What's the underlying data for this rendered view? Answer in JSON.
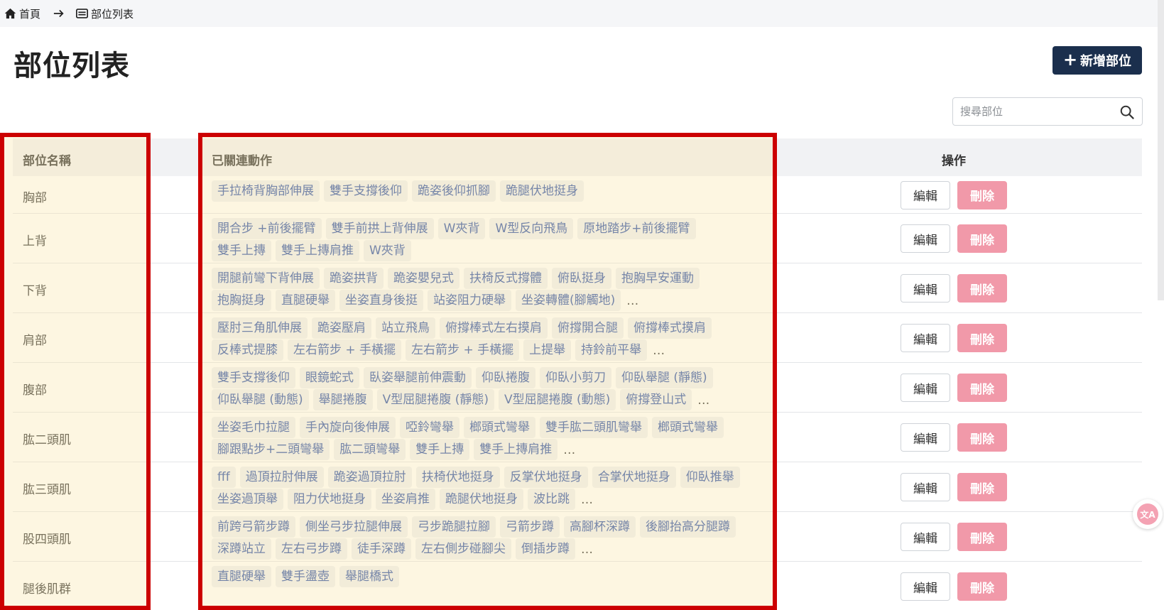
{
  "breadcrumb": {
    "home": "首頁",
    "current": "部位列表"
  },
  "page": {
    "title": "部位列表",
    "add_label": "新增部位"
  },
  "search": {
    "placeholder": "搜尋部位"
  },
  "table": {
    "headers": {
      "name": "部位名稱",
      "actions": "已關連動作",
      "ops": "操作"
    },
    "edit_label": "編輯",
    "delete_label": "刪除",
    "rows": [
      {
        "name": "胸部",
        "actions": [
          "手拉椅背胸部伸展",
          "雙手支撐後仰",
          "跪姿後仰抓腳",
          "跪腿伏地挺身"
        ],
        "more": ""
      },
      {
        "name": "上背",
        "actions": [
          "開合步 +前後擺臂",
          "雙手前拱上背伸展",
          "W夾背",
          "W型反向飛鳥",
          "原地踏步+前後擺臂",
          "雙手上摶",
          "雙手上摶肩推",
          "W夾背"
        ],
        "more": ""
      },
      {
        "name": "下背",
        "actions": [
          "開腿前彎下背伸展",
          "跪姿拱背",
          "跪姿嬰兒式",
          "扶椅反式撐體",
          "俯臥挺身",
          "抱胸早安運動",
          "抱胸挺身",
          "直腿硬舉",
          "坐姿直身後挺",
          "站姿阻力硬舉",
          "坐姿轉體(腳觸地)"
        ],
        "more": "…"
      },
      {
        "name": "肩部",
        "actions": [
          "壓肘三角肌伸展",
          "跪姿壓肩",
          "站立飛鳥",
          "俯撐棒式左右摸肩",
          "俯撐開合腿",
          "俯撐棒式摸肩",
          "反棒式提膝",
          "左右箭步 + 手橫擺",
          "左右箭步 + 手橫擺",
          "上提舉",
          "持鈴前平舉"
        ],
        "more": "…"
      },
      {
        "name": "腹部",
        "actions": [
          "雙手支撐後仰",
          "眼鏡蛇式",
          "臥姿舉腿前伸震動",
          "仰臥捲腹",
          "仰臥小剪刀",
          "仰臥舉腿 (靜態)",
          "仰臥舉腿 (動態)",
          "舉腿捲腹",
          "V型屈腿捲腹 (靜態)",
          "V型屈腿捲腹 (動態)",
          "俯撐登山式"
        ],
        "more": "…"
      },
      {
        "name": "肱二頭肌",
        "actions": [
          "坐姿毛巾拉腿",
          "手內旋向後伸展",
          "啞鈴彎舉",
          "榔頭式彎舉",
          "雙手肱二頭肌彎舉",
          "榔頭式彎舉",
          "腳跟點步+二頭彎舉",
          "肱二頭彎舉",
          "雙手上摶",
          "雙手上摶肩推"
        ],
        "more": "…"
      },
      {
        "name": "肱三頭肌",
        "actions": [
          "fff",
          "過頂拉肘伸展",
          "跪姿過頂拉肘",
          "扶椅伏地挺身",
          "反掌伏地挺身",
          "合掌伏地挺身",
          "仰臥推舉",
          "坐姿過頂舉",
          "阻力伏地挺身",
          "坐姿肩推",
          "跪腿伏地挺身",
          "波比跳"
        ],
        "more": "…"
      },
      {
        "name": "股四頭肌",
        "actions": [
          "前跨弓箭步蹲",
          "側坐弓步拉腿伸展",
          "弓步跪腿拉腳",
          "弓箭步蹲",
          "高腳杯深蹲",
          "後腳抬高分腿蹲",
          "深蹲站立",
          "左右弓步蹲",
          "徒手深蹲",
          "左右側步碰腳尖",
          "倒插步蹲"
        ],
        "more": "…"
      },
      {
        "name": "腿後肌群",
        "actions": [
          "直腿硬舉",
          "雙手盪壺",
          "舉腿橋式"
        ],
        "more": ""
      }
    ]
  }
}
